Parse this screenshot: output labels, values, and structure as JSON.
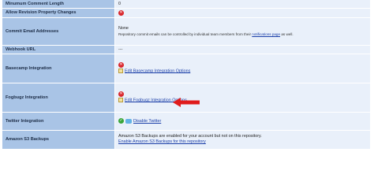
{
  "rows": [
    {
      "label": "Minumum Comment Length",
      "value": "0"
    },
    {
      "label": "Allow Revision Property Changes"
    },
    {
      "label": "Commit Email Addresses",
      "value": "None",
      "note_prefix": "Repository commit emails can be controlled by individual team members from their ",
      "note_link": "notifications page",
      "note_suffix": " as well."
    },
    {
      "label": "Webhook URL",
      "value": "---"
    },
    {
      "label": "Basecamp Integration",
      "link": "Edit Basecamp Integration Options"
    },
    {
      "label": "Fogbugz Integration",
      "link": "Edit Fogbugz Integration Options"
    },
    {
      "label": "Twitter Integration",
      "link": "Disable Twitter"
    },
    {
      "label": "Amazon S3 Backups",
      "value": "Amazon S3 Backups are enabled for your account but not on this repository.",
      "link": "Enable Amazon S3 Backups for this repository"
    }
  ],
  "icons": {
    "disabled": "x-icon",
    "enabled": "check-icon",
    "edit": "edit-icon",
    "twitter": "twitter-icon",
    "annotation": "red-arrow-icon"
  },
  "colors": {
    "label_bg": "#a9c4e6",
    "value_bg": "#e9f0fa",
    "link": "#1a3ea8",
    "disabled_icon": "#d9262b",
    "enabled_icon": "#3aa63a",
    "arrow": "#e01b1b"
  }
}
